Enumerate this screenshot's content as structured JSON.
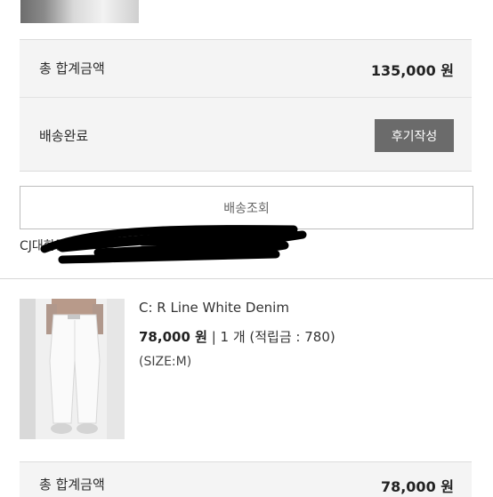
{
  "order_top": {
    "total_label": "총 합계금액",
    "total_amount": "135,000 원",
    "status_label": "배송완료",
    "review_button": "후기작성",
    "track_button": "배송조회",
    "carrier_text": "CJ대한통운"
  },
  "product": {
    "name": "C: R Line White Denim",
    "price": "78,000 원",
    "details": "| 1 개 (적립금 : 780)",
    "size": "(SIZE:M)"
  },
  "order_bottom": {
    "total_label": "총 합계금액",
    "total_amount": "78,000 원"
  },
  "colors": {
    "panel_bg": "#f4f4f4",
    "button_bg": "#6b6b6b",
    "redaction": "#000000"
  }
}
